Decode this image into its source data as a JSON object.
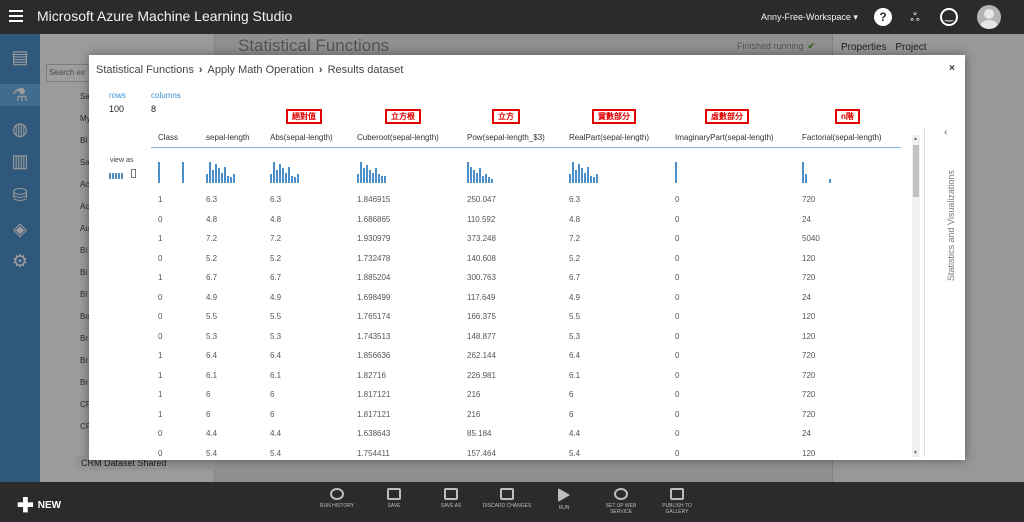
{
  "app": {
    "title": "Microsoft Azure Machine Learning Studio",
    "workspace": "Anny-Free-Workspace ▾"
  },
  "background": {
    "search_placeholder": "Search ex",
    "canvas_title": "Statistical Functions",
    "status": "Finished running",
    "props_tabs": [
      "Properties",
      "Project"
    ],
    "palette_rows": [
      "Sa",
      "My",
      "Bl",
      "Sa",
      "Ac",
      "Ac",
      "Au",
      "Bi",
      "Bi",
      "Bl",
      "Bo",
      "Br",
      "Br",
      "Br",
      "CF",
      "CF"
    ],
    "palette_bottom": "CRM Dataset Shared"
  },
  "dialog": {
    "breadcrumb": [
      "Statistical Functions",
      "Apply Math Operation",
      "Results dataset"
    ],
    "rows_label": "rows",
    "rows_value": "100",
    "columns_label": "columns",
    "columns_value": "8",
    "view_as": "view as",
    "side_label": "Statistics and Visualizations",
    "annotations": [
      "絕對值",
      "立方根",
      "立方",
      "實數部分",
      "虛數部分",
      "n階"
    ],
    "columns": [
      "Class",
      "sepal-length",
      "Abs(sepal-length)",
      "Cuberoot(sepal-length)",
      "Pow(sepal-length_$3)",
      "RealPart(sepal-length)",
      "ImaginaryPart(sepal-length)",
      "Factorial(sepal-length)"
    ],
    "rows": [
      [
        "1",
        "6.3",
        "6.3",
        "1.846915",
        "250.047",
        "6.3",
        "0",
        "720"
      ],
      [
        "0",
        "4.8",
        "4.8",
        "1.686865",
        "110.592",
        "4.8",
        "0",
        "24"
      ],
      [
        "1",
        "7.2",
        "7.2",
        "1.930979",
        "373.248",
        "7.2",
        "0",
        "5040"
      ],
      [
        "0",
        "5.2",
        "5.2",
        "1.732478",
        "140.608",
        "5.2",
        "0",
        "120"
      ],
      [
        "1",
        "6.7",
        "6.7",
        "1.885204",
        "300.763",
        "6.7",
        "0",
        "720"
      ],
      [
        "0",
        "4.9",
        "4.9",
        "1.698499",
        "117.649",
        "4.9",
        "0",
        "24"
      ],
      [
        "0",
        "5.5",
        "5.5",
        "1.765174",
        "166.375",
        "5.5",
        "0",
        "120"
      ],
      [
        "0",
        "5.3",
        "5.3",
        "1.743513",
        "148.877",
        "5.3",
        "0",
        "120"
      ],
      [
        "1",
        "6.4",
        "6.4",
        "1.856636",
        "262.144",
        "6.4",
        "0",
        "720"
      ],
      [
        "1",
        "6.1",
        "6.1",
        "1.82716",
        "226.981",
        "6.1",
        "0",
        "720"
      ],
      [
        "1",
        "6",
        "6",
        "1.817121",
        "216",
        "6",
        "0",
        "720"
      ],
      [
        "1",
        "6",
        "6",
        "1.817121",
        "216",
        "6",
        "0",
        "720"
      ],
      [
        "0",
        "4.4",
        "4.4",
        "1.638643",
        "85.184",
        "4.4",
        "0",
        "24"
      ],
      [
        "0",
        "5.4",
        "5.4",
        "1.754411",
        "157.464",
        "5.4",
        "0",
        "120"
      ]
    ]
  },
  "toolbar": {
    "new_label": "NEW",
    "items": [
      "RUN HISTORY",
      "SAVE",
      "SAVE AS",
      "DISCARD CHANGES",
      "RUN",
      "SET UP WEB SERVICE",
      "PUBLISH TO GALLERY"
    ]
  },
  "colors": {
    "accent": "#4c8ec7",
    "annotation": "#e00000",
    "topbar": "#2b2b2b"
  }
}
